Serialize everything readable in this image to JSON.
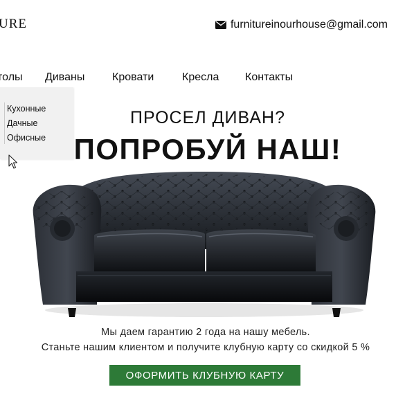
{
  "header": {
    "logo": "URE",
    "email": "furnitureinourhouse@gmail.com",
    "email_icon": "envelope-icon"
  },
  "nav": {
    "items": [
      "толы",
      "Диваны",
      "Кровати",
      "Кресла",
      "Контакты"
    ]
  },
  "dropdown": {
    "items": [
      "Кухонные",
      "Дачные",
      "Офисные"
    ]
  },
  "hero": {
    "line1": "ПРОСЕЛ ДИВАН?",
    "line2": "ПОПРОБУЙ НАШ!"
  },
  "description": {
    "line1": "Мы даем гарантию 2 года на нашу мебель.",
    "line2": "Станьте нашим клиентом и получите клубную карту со скидкой 5 %"
  },
  "cta": {
    "label": "ОФОРМИТЬ КЛУБНУЮ КАРТУ",
    "color": "#2d7a37"
  },
  "colors": {
    "text": "#111111",
    "dropdown_bg": "#f1f1f1"
  }
}
